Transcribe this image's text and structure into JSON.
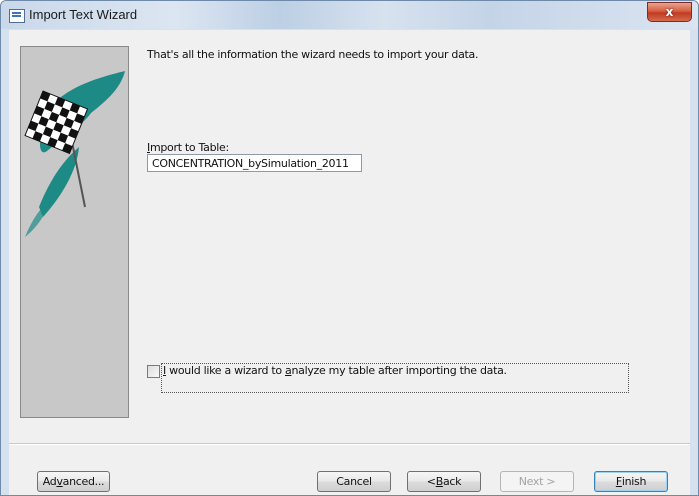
{
  "window": {
    "title": "Import Text Wizard",
    "close_label": "x"
  },
  "main": {
    "intro_text": "That's all the information the wizard needs to import your data.",
    "import_label_prefix": "",
    "import_label_underlined": "I",
    "import_label_rest": "mport to Table:",
    "table_name_value": "CONCENTRATION_bySimulation_2011",
    "analyze_checkbox": {
      "checked": false,
      "label_underlined": "I",
      "label_part2": " would like a wizard to ",
      "label_underlined2": "a",
      "label_rest": "nalyze my table after importing the data."
    }
  },
  "buttons": {
    "advanced": {
      "pre": "Ad",
      "ul": "v",
      "post": "anced..."
    },
    "cancel": {
      "pre": "Cancel",
      "ul": "",
      "post": ""
    },
    "back": {
      "pre": "< ",
      "ul": "B",
      "post": "ack"
    },
    "next": {
      "pre": "Next >",
      "ul": "",
      "post": ""
    },
    "finish": {
      "pre": "",
      "ul": "F",
      "post": "inish"
    }
  },
  "colors": {
    "sidebar": "#c8c8c8",
    "flag_streak": "#1e8a86",
    "close_button": "#c23b22"
  },
  "icons": [
    "app-icon",
    "checkered-flag-icon"
  ]
}
